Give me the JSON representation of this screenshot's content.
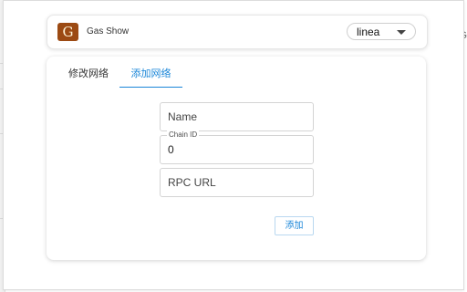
{
  "background": {
    "edge_text": "G"
  },
  "header": {
    "logo_letter": "G",
    "title": "Gas Show",
    "network_select": {
      "value": "linea"
    }
  },
  "tabs": [
    {
      "label": "修改网络",
      "active": false
    },
    {
      "label": "添加网络",
      "active": true
    }
  ],
  "form": {
    "name": {
      "placeholder": "Name",
      "value": ""
    },
    "chain_id": {
      "label": "Chain ID",
      "value": "0"
    },
    "rpc_url": {
      "placeholder": "RPC URL",
      "value": ""
    },
    "submit_label": "添加"
  },
  "colors": {
    "accent": "#1a86d8",
    "logo_background": "#9c4a13",
    "border": "#d4d4d4"
  },
  "icons": {
    "dropdown": "chevron-down-icon"
  }
}
